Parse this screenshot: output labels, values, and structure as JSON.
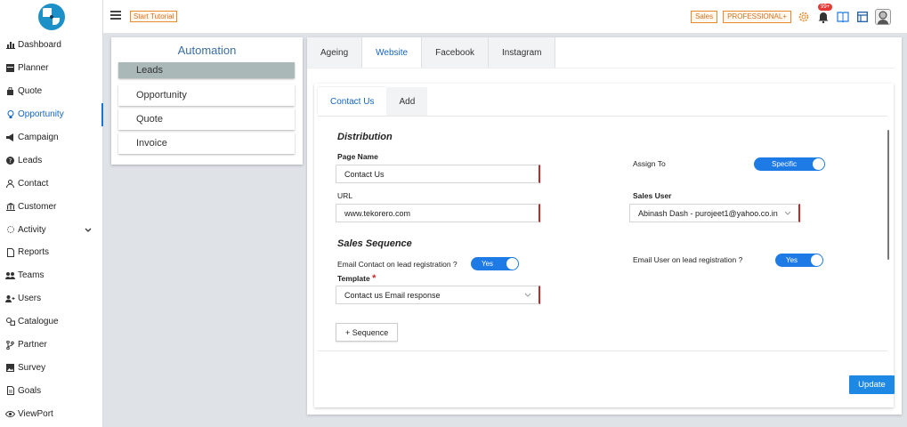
{
  "header": {
    "tutorial_label": "Start Tutorial",
    "sales_tag": "Sales",
    "plan_tag": "PROFESSIONAL+",
    "notification_count": "99+"
  },
  "sidebar": {
    "items": [
      {
        "label": "Dashboard",
        "icon": "bar-chart-icon"
      },
      {
        "label": "Planner",
        "icon": "calendar-icon"
      },
      {
        "label": "Quote",
        "icon": "bag-icon"
      },
      {
        "label": "Opportunity",
        "icon": "bulb-icon"
      },
      {
        "label": "Campaign",
        "icon": "megaphone-icon"
      },
      {
        "label": "Leads",
        "icon": "question-circle-icon"
      },
      {
        "label": "Contact",
        "icon": "person-icon"
      },
      {
        "label": "Customer",
        "icon": "bank-icon"
      },
      {
        "label": "Activity",
        "icon": "gear-outline-icon"
      },
      {
        "label": "Reports",
        "icon": "document-icon"
      },
      {
        "label": "Teams",
        "icon": "group-icon"
      },
      {
        "label": "Users",
        "icon": "user-plus-icon"
      },
      {
        "label": "Catalogue",
        "icon": "shapes-icon"
      },
      {
        "label": "Partner",
        "icon": "branch-icon"
      },
      {
        "label": "Survey",
        "icon": "image-icon"
      },
      {
        "label": "Goals",
        "icon": "file-icon"
      },
      {
        "label": "ViewPort",
        "icon": "eye-icon"
      }
    ]
  },
  "automation": {
    "title": "Automation",
    "items": [
      "Leads",
      "Opportunity",
      "Quote",
      "Invoice"
    ]
  },
  "tabs": [
    "Ageing",
    "Website",
    "Facebook",
    "Instagram"
  ],
  "subtabs": [
    "Contact Us",
    "Add"
  ],
  "form": {
    "distribution_title": "Distribution",
    "page_name_label": "Page Name",
    "page_name_value": "Contact Us",
    "url_label": "URL",
    "url_value": "www.tekorero.com",
    "assign_to_label": "Assign To",
    "assign_to_value": "Specific",
    "sales_user_label": "Sales User",
    "sales_user_value": "Abinash Dash - purojeet1@yahoo.co.in",
    "sales_sequence_title": "Sales Sequence",
    "email_contact_label": "Email Contact on lead registration ?",
    "email_contact_value": "Yes",
    "email_user_label": "Email User on lead registration ?",
    "email_user_value": "Yes",
    "template_label": "Template",
    "template_required": "*",
    "template_value": "Contact us Email response",
    "sequence_button": "+ Sequence",
    "update_button": "Update"
  },
  "colors": {
    "accent": "#1e88e5",
    "required": "#c62828",
    "tag": "#e88a2e",
    "active_item": "#aab8b8"
  }
}
